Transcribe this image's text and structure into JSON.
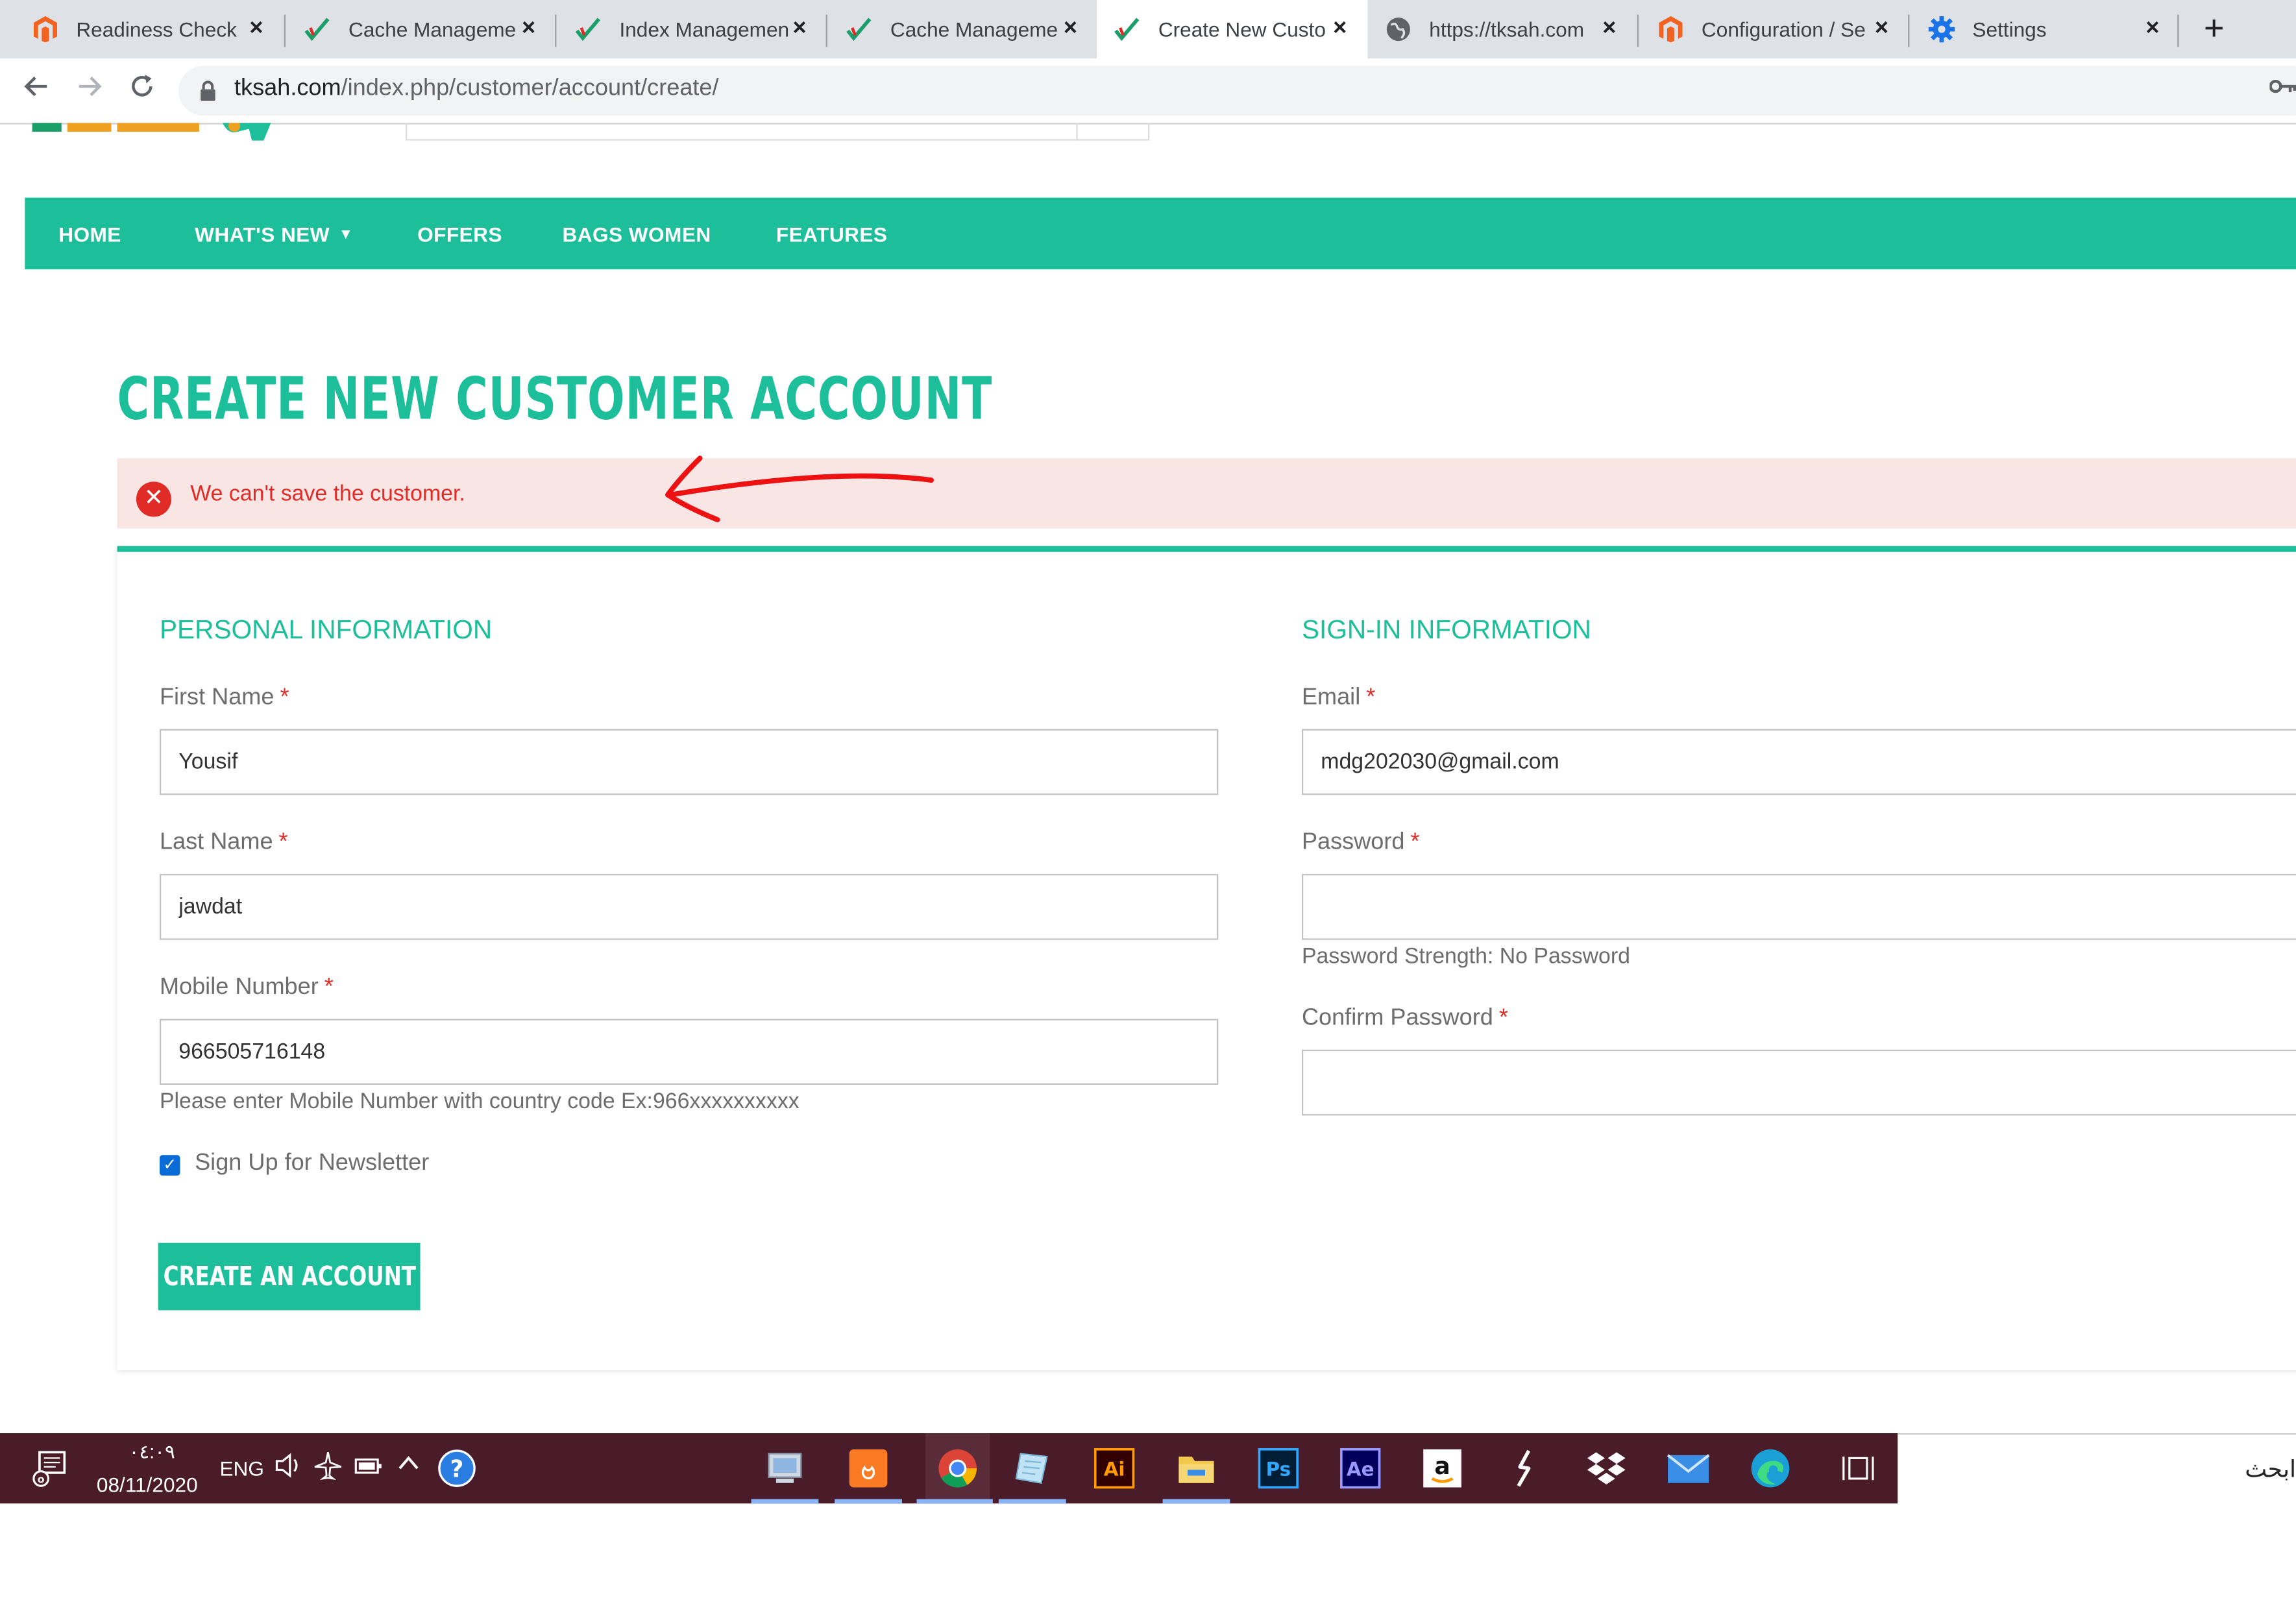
{
  "browser": {
    "tabs": [
      {
        "label": "Readiness Check",
        "icon": "magento-icon",
        "active": false
      },
      {
        "label": "Cache Manageme",
        "icon": "check-icon",
        "active": false
      },
      {
        "label": "Index Managemen",
        "icon": "check-icon",
        "active": false
      },
      {
        "label": "Cache Manageme",
        "icon": "check-icon",
        "active": false
      },
      {
        "label": "Create New Custo",
        "icon": "check-icon",
        "active": true
      },
      {
        "label": "https://tksah.com",
        "icon": "globe-icon",
        "active": false
      },
      {
        "label": "Configuration / Se",
        "icon": "magento-icon",
        "active": false
      },
      {
        "label": "Settings",
        "icon": "gear-icon",
        "active": false
      }
    ],
    "close_glyph": "×",
    "new_tab_glyph": "+",
    "url_host": "tksah.com",
    "url_path": "/index.php/customer/account/create/"
  },
  "nav": {
    "items": [
      "HOME",
      "WHAT'S NEW",
      "OFFERS",
      "BAGS WOMEN",
      "FEATURES"
    ],
    "chevron": "▼"
  },
  "page": {
    "title": "CREATE NEW CUSTOMER ACCOUNT",
    "error_message": "We can't save the customer.",
    "error_icon_glyph": "✕"
  },
  "personal": {
    "legend": "PERSONAL INFORMATION",
    "first_name_label": "First Name",
    "first_name_value": "Yousif",
    "last_name_label": "Last Name",
    "last_name_value": "jawdat",
    "mobile_label": "Mobile Number",
    "mobile_value": "966505716148",
    "mobile_note": "Please enter Mobile Number with country code Ex:966xxxxxxxxxx",
    "newsletter_label": "Sign Up for Newsletter",
    "newsletter_checked": true,
    "required_mark": "*"
  },
  "signin": {
    "legend": "SIGN-IN INFORMATION",
    "email_label": "Email",
    "email_value": "mdg202030@gmail.com",
    "password_label": "Password",
    "password_value": "",
    "password_strength": "Password Strength: No Password",
    "confirm_label": "Confirm Password",
    "confirm_value": ""
  },
  "actions": {
    "create_account": "CREATE AN ACCOUNT"
  },
  "taskbar": {
    "time": "٠٤:٠٩",
    "date": "08/11/2020",
    "language": "ENG",
    "search_text": "ابحث",
    "apps": [
      "generic-app-icon",
      "xampp-icon",
      "chrome-icon",
      "notepad-icon",
      "illustrator-icon",
      "file-explorer-icon",
      "photoshop-icon",
      "after-effects-icon",
      "amazon-icon",
      "sublime-icon",
      "dropbox-icon",
      "mail-icon",
      "edge-icon",
      "task-view-icon"
    ],
    "illustrator_label": "Ai",
    "photoshop_label": "Ps",
    "after_effects_label": "Ae",
    "amazon_label": "a",
    "colors": {
      "bar": "#4a1c2a",
      "accent": "#1dbf9b",
      "error": "#e02b27"
    }
  }
}
